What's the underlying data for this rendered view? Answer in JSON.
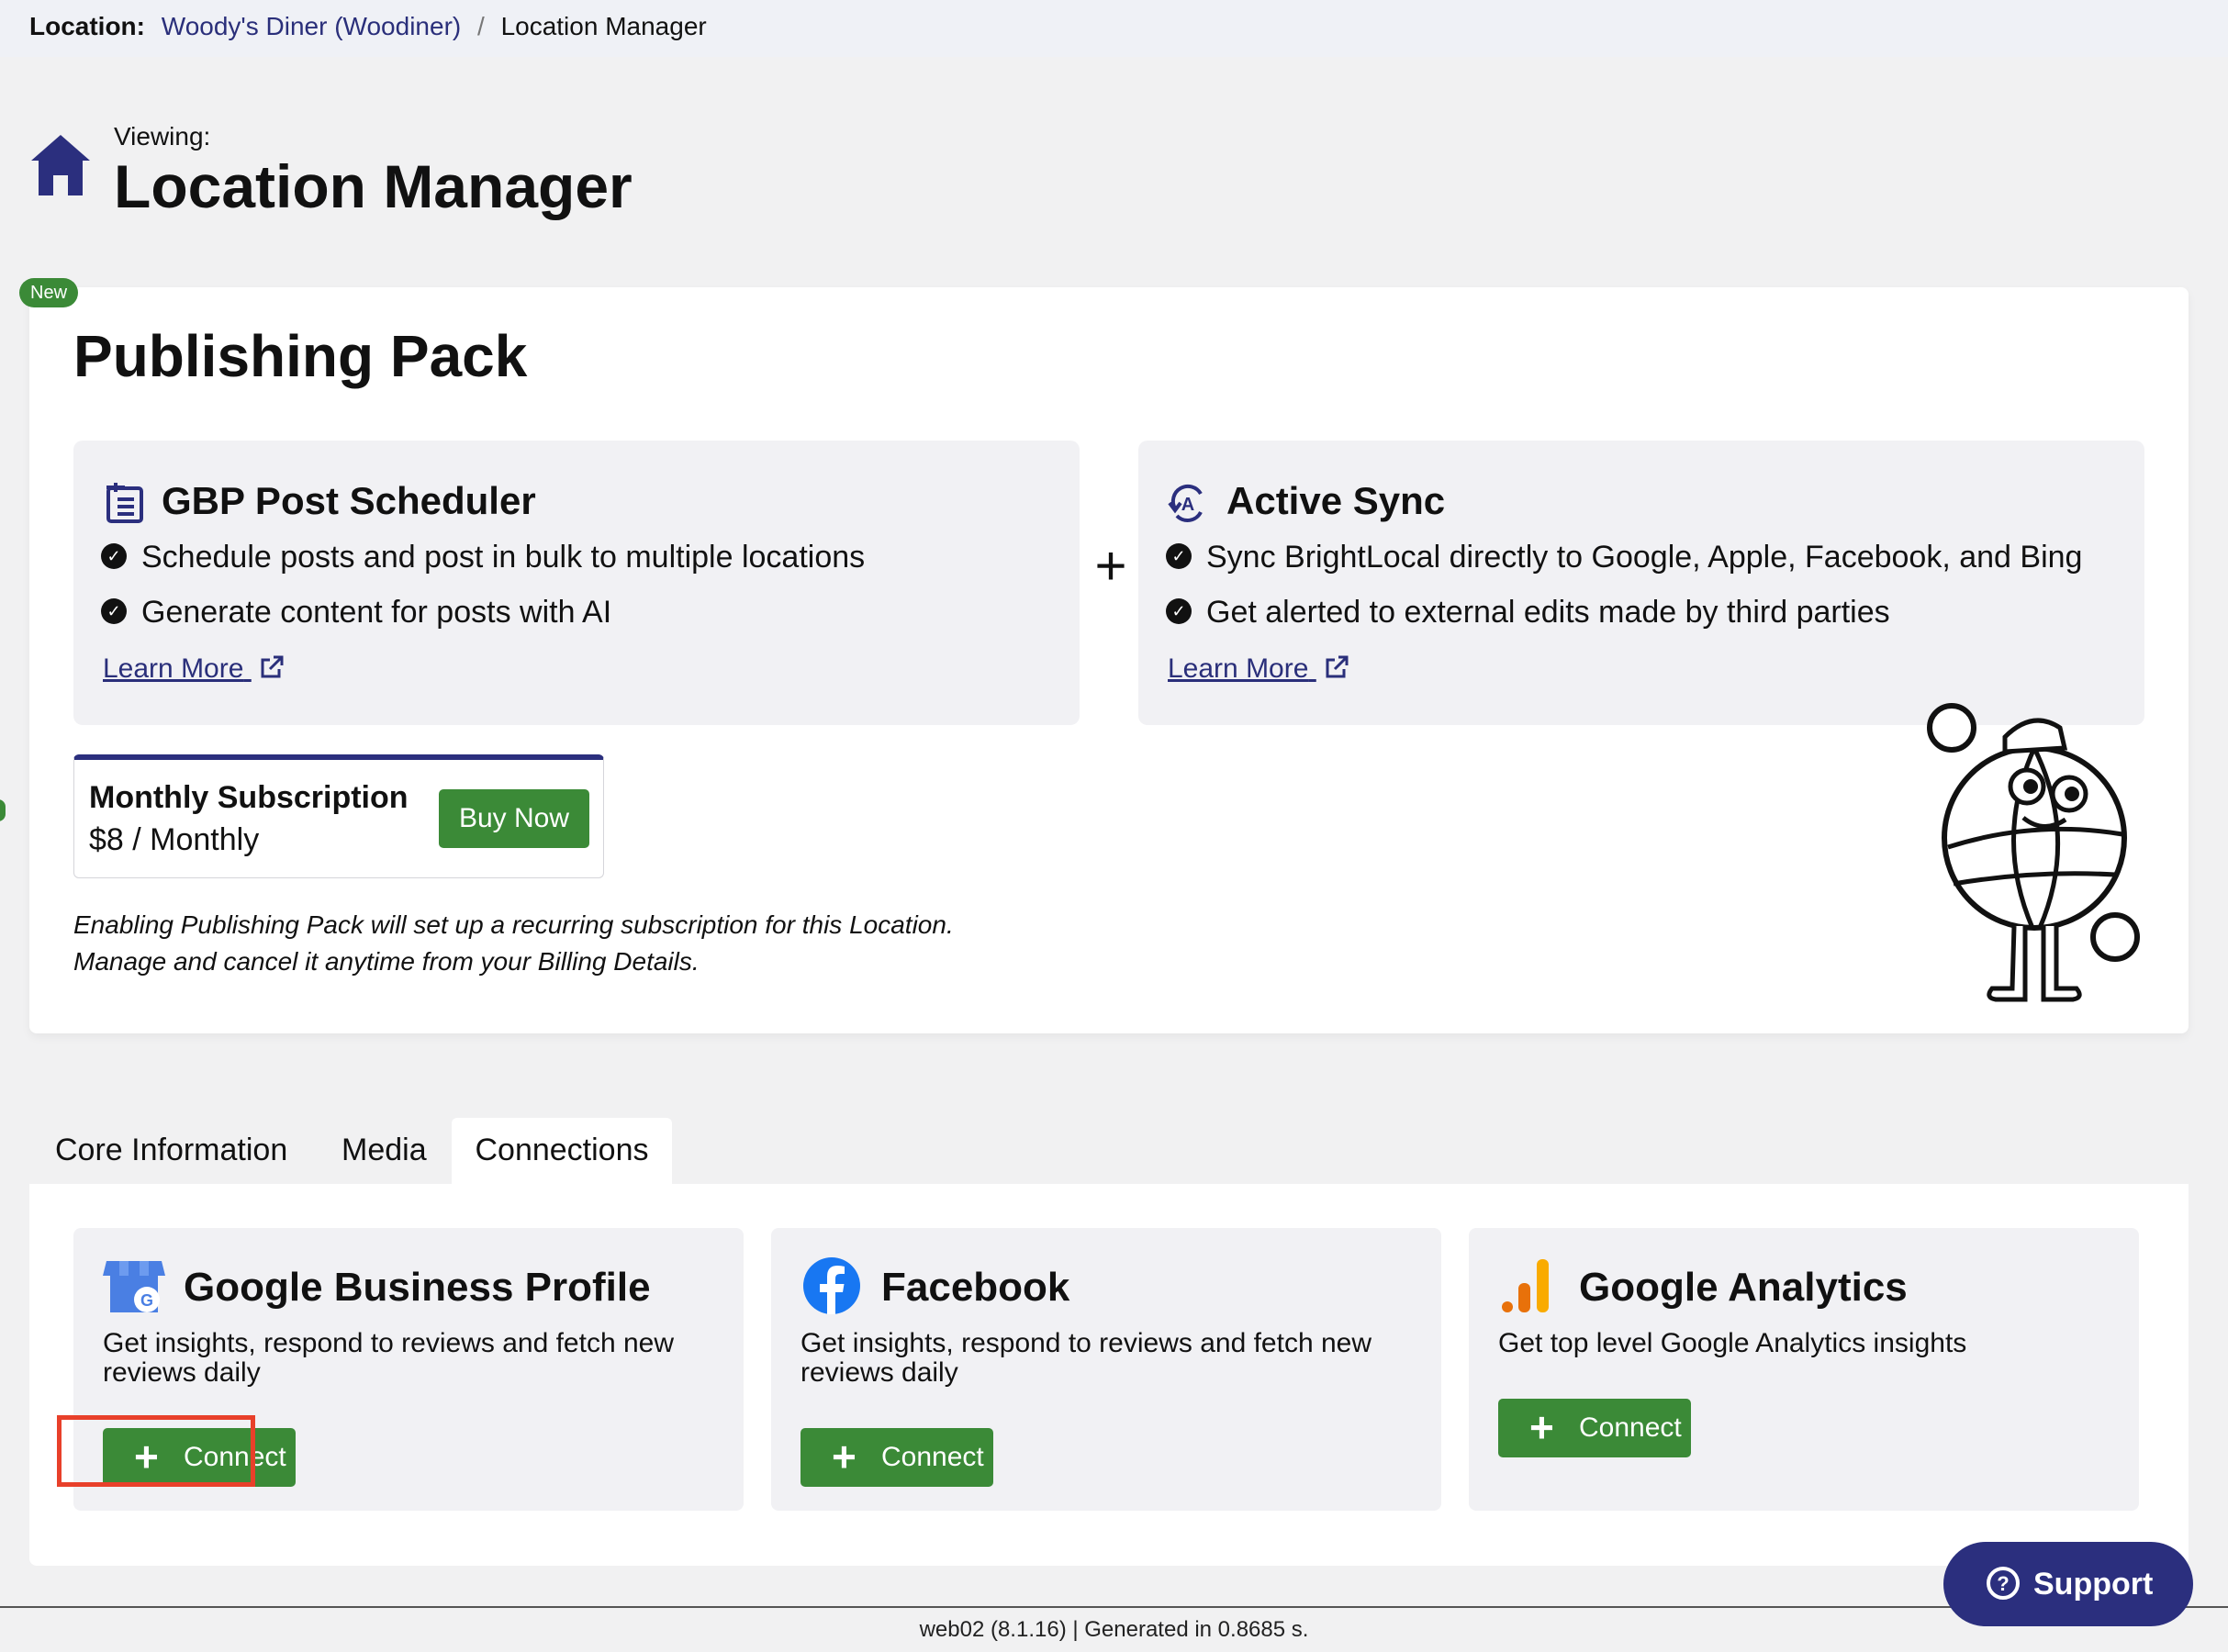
{
  "breadcrumb": {
    "label": "Location:",
    "location_link": "Woody's Diner (Woodiner)",
    "separator": "/",
    "current": "Location Manager"
  },
  "header": {
    "viewing": "Viewing:",
    "title": "Location Manager",
    "icon": "home-icon"
  },
  "badge": {
    "new": "New"
  },
  "publishing_pack": {
    "title": "Publishing Pack",
    "features": [
      {
        "icon": "calendar-list-icon",
        "title": "GBP Post Scheduler",
        "items": [
          "Schedule posts and post in bulk to multiple locations",
          "Generate content for posts with AI"
        ],
        "learn_more": "Learn More"
      },
      {
        "icon": "sync-icon",
        "title": "Active Sync",
        "items": [
          "Sync BrightLocal directly to Google, Apple, Facebook, and Bing",
          "Get alerted to external edits made by third parties"
        ],
        "learn_more": "Learn More"
      }
    ],
    "plus": "+",
    "subscription": {
      "title": "Monthly Subscription",
      "price": "$8 / Monthly",
      "buy_label": "Buy Now"
    },
    "note_line1": "Enabling Publishing Pack will set up a recurring subscription for this Location.",
    "note_line2": "Manage and cancel it anytime from your Billing Details."
  },
  "tabs": [
    "Core Information",
    "Media",
    "Connections"
  ],
  "active_tab": "Connections",
  "connections": [
    {
      "icon": "google-business-icon",
      "title": "Google Business Profile",
      "description": "Get insights, respond to reviews and fetch new reviews daily",
      "button": "Connect"
    },
    {
      "icon": "facebook-icon",
      "title": "Facebook",
      "description": "Get insights, respond to reviews and fetch new reviews daily",
      "button": "Connect"
    },
    {
      "icon": "google-analytics-icon",
      "title": "Google Analytics",
      "description": "Get top level Google Analytics insights",
      "button": "Connect"
    }
  ],
  "connect_plus": "+",
  "footer": "web02 (8.1.16) | Generated in 0.8685 s.",
  "support": "Support",
  "colors": {
    "brand_navy": "#2b2f7e",
    "green": "#3b8a37",
    "highlight": "#e8402a"
  }
}
